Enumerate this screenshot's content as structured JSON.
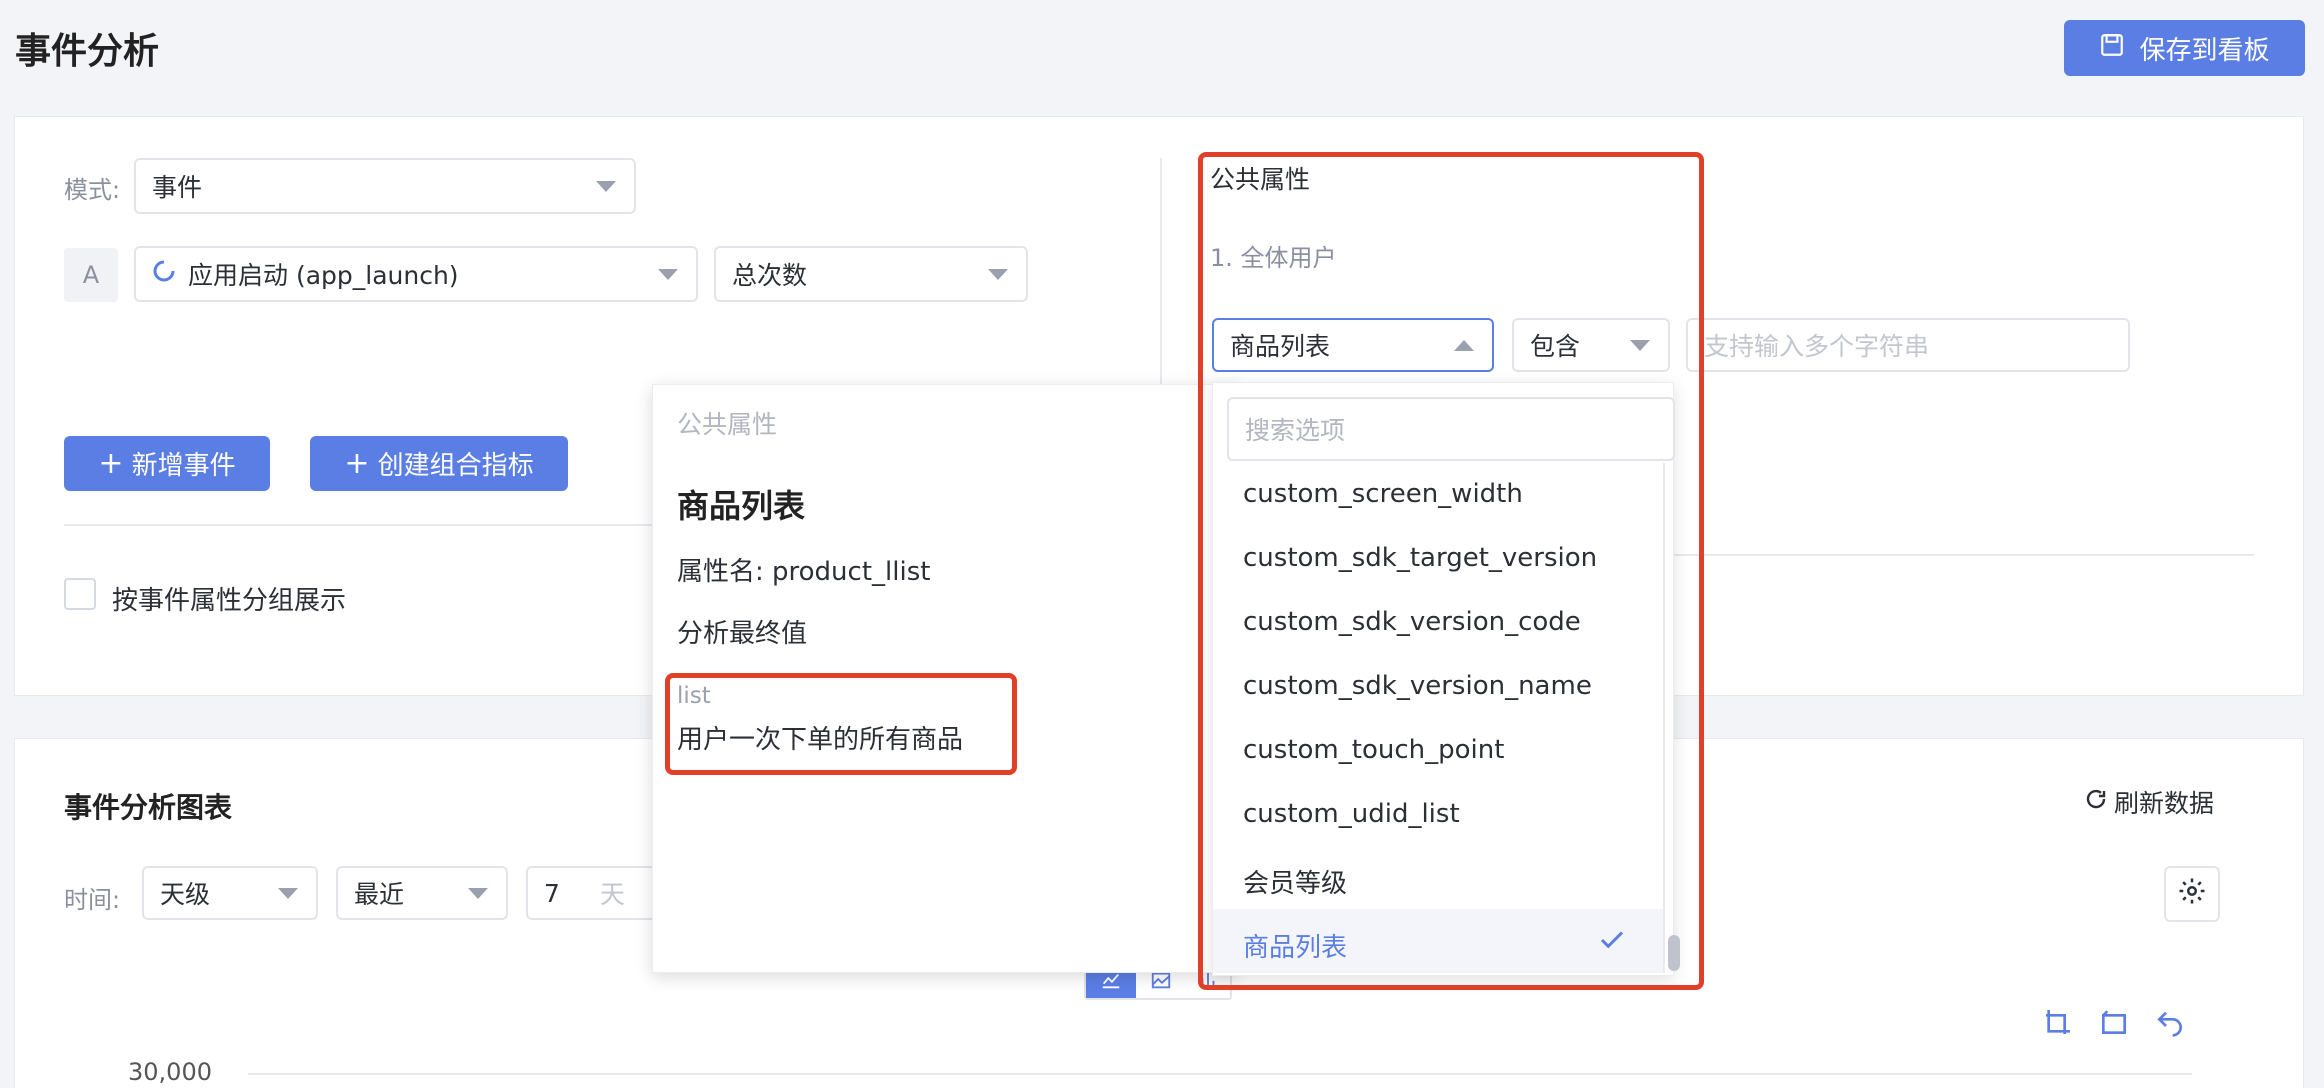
{
  "header": {
    "title": "事件分析",
    "save_label": "保存到看板"
  },
  "query": {
    "mode_label": "模式:",
    "mode_value": "事件",
    "series_letter": "A",
    "event_value": "应用启动 (app_launch)",
    "metric_value": "总次数",
    "add_event_label": "新增事件",
    "create_metric_label": "创建组合指标",
    "group_checkbox_label": "按事件属性分组展示"
  },
  "filter": {
    "section_title": "公共属性",
    "user_group": "1. 全体用户",
    "property_value": "商品列表",
    "operator_value": "包含",
    "value_placeholder": "支持输入多个字符串"
  },
  "property_popover": {
    "category": "公共属性",
    "name": "商品列表",
    "attr_name": "属性名: product_llist",
    "analysis": "分析最终值",
    "type": "list",
    "description": "用户一次下单的所有商品"
  },
  "dropdown": {
    "search_placeholder": "搜索选项",
    "items": [
      "custom_screen_width",
      "custom_sdk_target_version",
      "custom_sdk_version_code",
      "custom_sdk_version_name",
      "custom_touch_point",
      "custom_udid_list",
      "会员等级",
      "商品列表"
    ],
    "selected_index": 7
  },
  "chart_panel": {
    "title": "事件分析图表",
    "refresh_label": "刷新数据",
    "time_label": "时间:",
    "granularity": "天级",
    "range": "最近",
    "days_value": "7",
    "days_unit": "天",
    "y_tick": "30,000"
  },
  "colors": {
    "primary": "#5b7ee5",
    "highlight": "#e0402a",
    "selected_bg": "#f3f5fa"
  }
}
